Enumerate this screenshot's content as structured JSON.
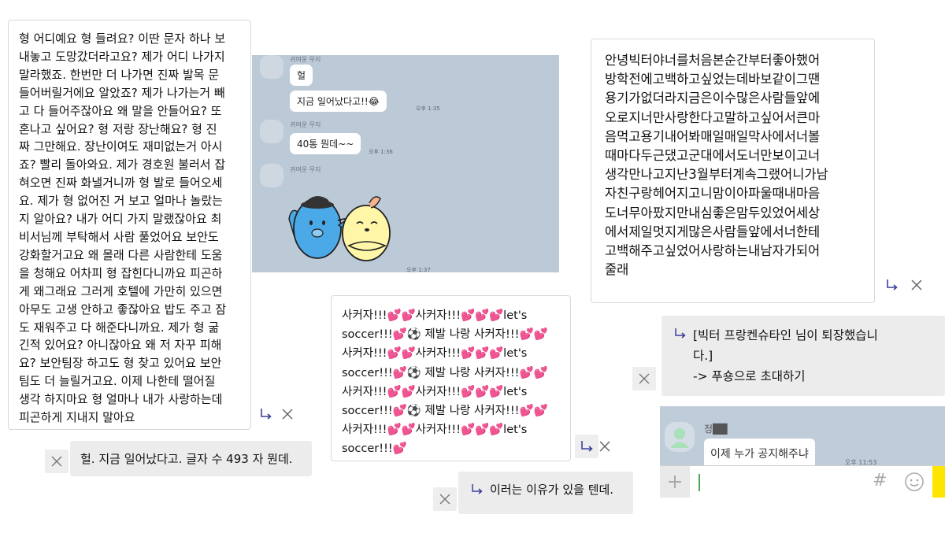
{
  "left_message": {
    "lines": [
      "형 어디예요 형 들려요? 이딴 문자 하나 보",
      "내놓고 도망갔더라고요? 제가 어디 나가지",
      "말라했죠. 한번만 더 나가면 진짜 발목 문",
      "들어버릴거에요 알았죠? 제가 나가는거 빼",
      "고 다 들어주잖아요 왜 말을 안들어요? 또",
      "혼나고 싶어요? 형 저랑 장난해요? 형 진",
      "짜 그만해요. 장난이여도 재미없는거 아시",
      "죠? 빨리 돌아와요. 제가 경호원 불러서 잡",
      "혀오면 진짜 화낼거니까 형 발로 들어오세",
      "요. 제가 형 없어진 거 보고 얼마나 놀랐는",
      "지 알아요? 내가 어디 가지 말랬잖아요 최",
      "비서님께 부탁해서 사람 풀었어요 보안도",
      "강화할거고요 왜 몰래 다른 사람한테 도움",
      "을 청해요 어차피 형 잡힌다니까요 피곤하",
      "게 왜그래요 그러게 호텔에 가만히 있으면",
      "아무도 고생 안하고 좋잖아요 밥도 주고 잠",
      "도 재워주고 다 해준다니까요. 제가 형 굶",
      "긴적 있어요? 아니잖아요 왜 저 자꾸 피해",
      "요? 보안팀장 하고도 형 찾고 있어요 보안",
      "팀도 더 늘릴거고요. 이제 나한테 떨어질",
      "생각 하지마요 형 얼마나 내가 사랑하는데",
      "피곤하게 지내지 말아요"
    ]
  },
  "right_message": {
    "lines": [
      "안녕빅터야너를처음본순간부터좋아했어",
      "방학전에고백하고싶었는데바보같이그땐",
      "용기가없더라지금은이수많은사람들앞에",
      "오로지너만사랑한다고말하고싶어서큰마",
      "음먹고용기내어봐매일매일막사에서너볼",
      "때마다두근댔고군대에서도너만보이고너",
      "생각만나고지난3월부터계속그랬어니가남",
      "자친구랑헤어지고니맘이아파울때내마음",
      "도너무아팠지만내심좋은맘두있었어세상",
      "에서제일멋지게많은사람들앞에서너한테",
      "고백해주고싶었어사랑하는내남자가되어",
      "줄래"
    ]
  },
  "middle_message": {
    "lines": [
      "사커자!!!💕💕사커자!!!💕💕💕let's",
      "soccer!!!💕⚽ 제발 나랑 사커자!!!💕💕",
      "사커자!!!💕💕사커자!!!💕💕💕let's",
      "soccer!!!💕⚽ 제발 나랑 사커자!!!💕💕",
      "사커자!!!💕💕사커자!!!💕💕💕let's",
      "soccer!!!💕⚽ 제발 나랑 사커자!!!💕💕",
      "사커자!!!💕💕사커자!!!💕💕💕let's",
      "soccer!!!💕"
    ]
  },
  "replies": {
    "reply_1": "헐. 지금 일어났다고. 글자 수 493 자 뭔데.",
    "reply_2": "이러는 이유가 있을 텐데.",
    "system_notice_line1": "[빅터 프랑켄슈타인 님이 퇴장했습니",
    "system_notice_line2": "다.]",
    "system_notice_line3": "-> 푸숑으로 초대하기"
  },
  "chat_screenshot_1": {
    "sender_name": "귀여운 무지",
    "messages": [
      {
        "text": "헐"
      },
      {
        "text": "지금 일어났다고!!😂",
        "time": "오후 1:35"
      },
      {
        "text": "40통 뭔데~~",
        "time": "오후 1:36"
      }
    ],
    "sticker_time": "오후 1:37"
  },
  "chat_screenshot_2": {
    "sender_name": "정██",
    "message": "이제 누가 공지해주냐",
    "time": "오후 11:53",
    "icons": [
      "plus-icon",
      "hash-icon",
      "emoji-icon"
    ]
  },
  "colors": {
    "chat_background": "#bccad8",
    "heart": "#e8408c",
    "accent_yellow": "#fee500"
  }
}
